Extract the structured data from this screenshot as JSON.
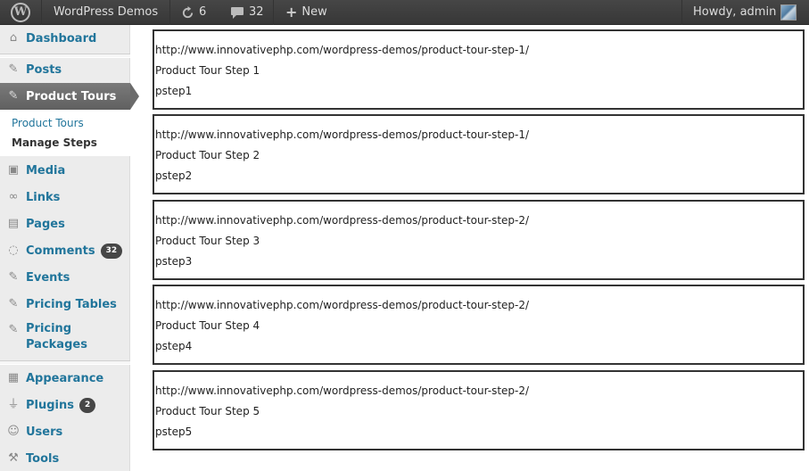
{
  "adminbar": {
    "site_name": "WordPress Demos",
    "updates_count": "6",
    "comments_count": "32",
    "new_label": "New",
    "howdy": "Howdy, admin"
  },
  "sidebar": {
    "dashboard": "Dashboard",
    "posts": "Posts",
    "product_tours": "Product Tours",
    "submenu": [
      "Product Tours",
      "Manage Steps"
    ],
    "media": "Media",
    "links": "Links",
    "pages": "Pages",
    "comments": "Comments",
    "comments_badge": "32",
    "events": "Events",
    "pricing_tables": "Pricing Tables",
    "pricing_packages_1": "Pricing",
    "pricing_packages_2": "Packages",
    "appearance": "Appearance",
    "plugins": "Plugins",
    "plugins_badge": "2",
    "users": "Users",
    "tools": "Tools"
  },
  "steps": [
    {
      "url": "http://www.innovativephp.com/wordpress-demos/product-tour-step-1/",
      "title": "Product Tour Step 1",
      "id": "pstep1"
    },
    {
      "url": "http://www.innovativephp.com/wordpress-demos/product-tour-step-1/",
      "title": "Product Tour Step 2",
      "id": "pstep2"
    },
    {
      "url": "http://www.innovativephp.com/wordpress-demos/product-tour-step-2/",
      "title": "Product Tour Step 3",
      "id": "pstep3"
    },
    {
      "url": "http://www.innovativephp.com/wordpress-demos/product-tour-step-2/",
      "title": "Product Tour Step 4",
      "id": "pstep4"
    },
    {
      "url": "http://www.innovativephp.com/wordpress-demos/product-tour-step-2/",
      "title": "Product Tour Step 5",
      "id": "pstep5"
    }
  ]
}
